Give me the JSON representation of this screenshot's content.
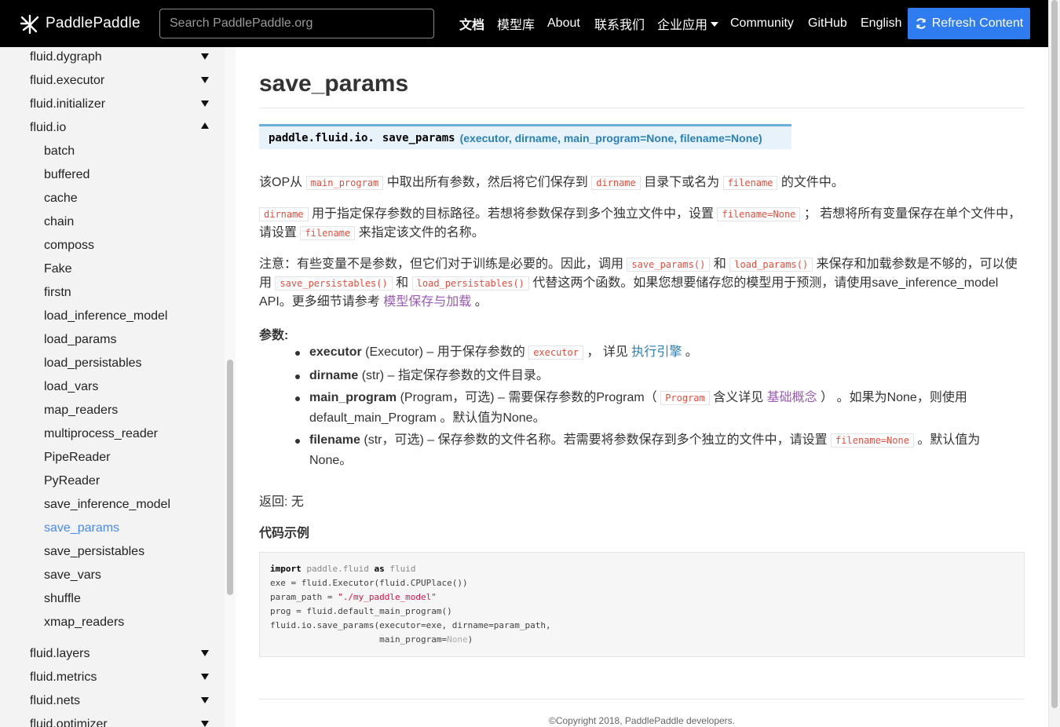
{
  "brand": {
    "name": "PaddlePaddle"
  },
  "search": {
    "placeholder": "Search PaddlePaddle.org"
  },
  "nav": {
    "docs": "文档",
    "models": "模型库",
    "about": "About",
    "contact": "联系我们",
    "enterprise": "企业应用",
    "community": "Community",
    "github": "GitHub",
    "english": "English",
    "refresh": "Refresh Content"
  },
  "sidebar": {
    "top_items": [
      "fluid.dygraph",
      "fluid.executor",
      "fluid.initializer",
      "fluid.io"
    ],
    "io_children": [
      "batch",
      "buffered",
      "cache",
      "chain",
      "composs",
      "Fake",
      "firstn",
      "load_inference_model",
      "load_params",
      "load_persistables",
      "load_vars",
      "map_readers",
      "multiprocess_reader",
      "PipeReader",
      "PyReader",
      "save_inference_model",
      "save_params",
      "save_persistables",
      "save_vars",
      "shuffle",
      "xmap_readers"
    ],
    "bottom_items": [
      "fluid.layers",
      "fluid.metrics",
      "fluid.nets",
      "fluid.optimizer"
    ],
    "active": "save_params"
  },
  "doc": {
    "title": "save_params",
    "sig_prefix": "paddle.fluid.io.",
    "sig_name": "save_params",
    "sig_params": "(executor, dirname, main_program=None, filename=None)",
    "p1": {
      "t1": "该OP从 ",
      "c1": "main_program",
      "t2": " 中取出所有参数，然后将它们保存到 ",
      "c2": "dirname",
      "t3": " 目录下或名为 ",
      "c3": "filename",
      "t4": " 的文件中。"
    },
    "p2": {
      "c1": "dirname",
      "t1": " 用于指定保存参数的目标路径。若想将参数保存到多个独立文件中，设置 ",
      "c2": "filename=None",
      "t2": " ； 若想将所有变量保存在单个文件中，请设置 ",
      "c3": "filename",
      "t3": " 来指定该文件的名称。"
    },
    "p3": {
      "t1": "注意：有些变量不是参数，但它们对于训练是必要的。因此，调用 ",
      "c1": "save_params()",
      "t2": " 和 ",
      "c2": "load_params()",
      "t3": " 来保存和加载参数是不够的，可以使用 ",
      "c3": "save_persistables()",
      "t4": " 和 ",
      "c4": "load_persistables()",
      "t5": " 代替这两个函数。如果您想要储存您的模型用于预测，请使用save_inference_model API。更多细节请参考 ",
      "link": "模型保存与加载",
      "t6": " 。"
    },
    "params_label": "参数:",
    "params": {
      "executor": {
        "name": "executor",
        "t1": " (Executor) – 用于保存参数的 ",
        "code": "executor",
        "t2": " ， 详见 ",
        "link": "执行引擎",
        "t3": " 。"
      },
      "dirname": {
        "name": "dirname",
        "t1": " (str) – 指定保存参数的文件目录。"
      },
      "main_program": {
        "name": "main_program",
        "t1": " (Program，可选) – 需要保存参数的Program（ ",
        "code": "Program",
        "t2": " 含义详见 ",
        "link": "基础概念",
        "t3": " ） 。如果为None，则使用 default_main_Program 。默认值为None。"
      },
      "filename": {
        "name": "filename",
        "t1": " (str，可选) – 保存参数的文件名称。若需要将参数保存到多个独立的文件中，请设置 ",
        "code": "filename=None",
        "t2": " 。默认值为 None。"
      }
    },
    "returns": "返回: 无",
    "example_label": "代码示例",
    "code": {
      "l1_kw1": "import",
      "l1_mod": " paddle.fluid ",
      "l1_kw2": "as",
      "l1_alias": " fluid",
      "l2": "exe = fluid.Executor(fluid.CPUPlace())",
      "l3_a": "param_path = ",
      "l3_str": "\"./my_paddle_model\"",
      "l4": "prog = fluid.default_main_program()",
      "l5": "fluid.io.save_params(executor=exe, dirname=param_path,",
      "l6_a": "                     main_program=",
      "l6_none": "None",
      "l6_b": ")"
    },
    "copyright": "©Copyright 2018, PaddlePaddle developers."
  }
}
